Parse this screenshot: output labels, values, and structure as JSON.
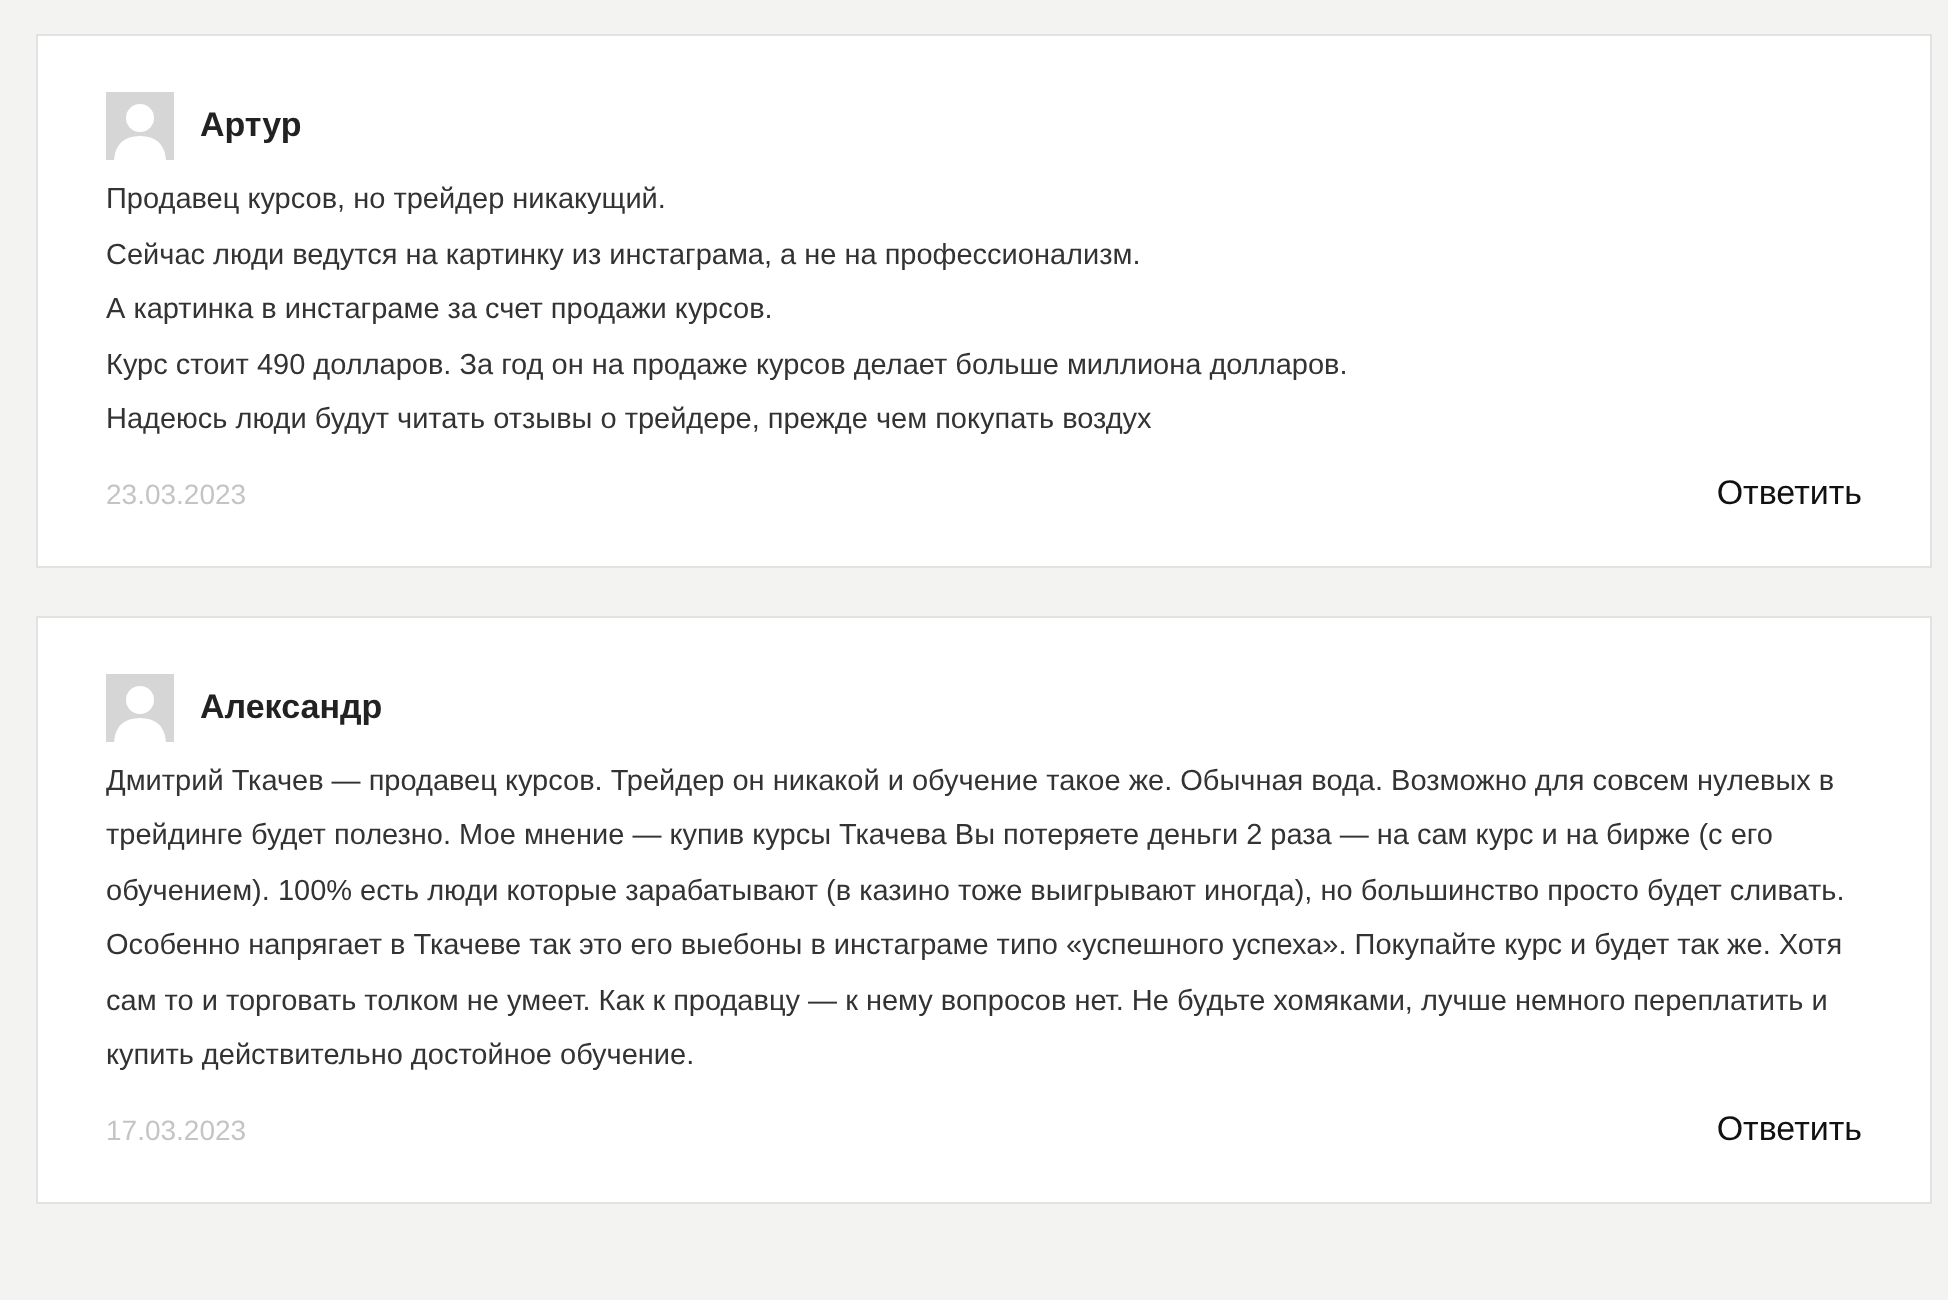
{
  "comments": [
    {
      "author": "Артур",
      "paragraphs": [
        "Продавец курсов, но трейдер никакущий.",
        "Сейчас люди ведутся на картинку из инстаграма, а не на профессионализм.",
        "А картинка в инстаграме за счет продажи курсов.",
        "Курс стоит 490 долларов. За год он на продаже курсов делает больше миллиона долларов.",
        "Надеюсь люди будут читать отзывы о трейдере, прежде чем покупать воздух"
      ],
      "date": "23.03.2023",
      "reply": "Ответить"
    },
    {
      "author": "Александр",
      "paragraphs": [
        "Дмитрий Ткачев — продавец курсов. Трейдер он никакой и обучение такое же. Обычная вода. Возможно для совсем нулевых в трейдинге будет полезно. Мое мнение — купив курсы Ткачева Вы потеряете деньги 2 раза — на сам курс и на бирже (с его обучением). 100% есть люди которые зарабатывают (в казино тоже выигрывают иногда), но большинство просто будет сливать.",
        "Особенно напрягает в Ткачеве так это его выебоны в инстаграме типо «успешного успеха». Покупайте курс и будет так же. Хотя сам то и торговать толком не умеет. Как к продавцу — к нему вопросов нет. Не будьте хомяками, лучше немного переплатить и купить действительно достойное обучение."
      ],
      "date": "17.03.2023",
      "reply": "Ответить"
    }
  ]
}
